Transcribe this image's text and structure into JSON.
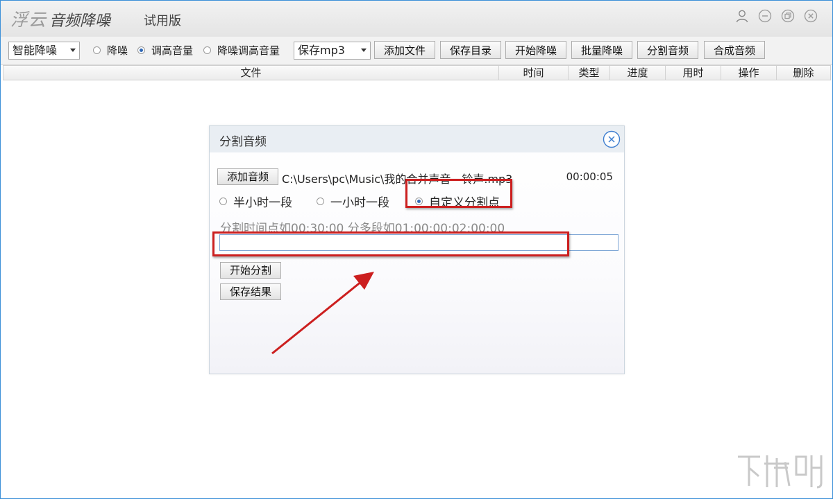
{
  "app": {
    "brand": "浮云",
    "product": "音频降噪",
    "edition": "试用版"
  },
  "toolbar": {
    "mode_select": "智能降噪",
    "radios": [
      {
        "label": "降噪",
        "checked": false
      },
      {
        "label": "调高音量",
        "checked": true
      },
      {
        "label": "降噪调高音量",
        "checked": false
      }
    ],
    "format_select": "保存mp3",
    "buttons": [
      "添加文件",
      "保存目录",
      "开始降噪",
      "批量降噪",
      "分割音频",
      "合成音频"
    ]
  },
  "table": {
    "columns": [
      "文件",
      "时间",
      "类型",
      "进度",
      "用时",
      "操作",
      "删除"
    ]
  },
  "dialog": {
    "title": "分割音频",
    "add_button": "添加音频",
    "file_path": "C:\\Users\\pc\\Music\\我的合并声音 - 铃声.mp3",
    "duration": "00:00:05",
    "options": [
      {
        "label": "半小时一段",
        "checked": false
      },
      {
        "label": "一小时一段",
        "checked": false
      },
      {
        "label": "自定义分割点",
        "checked": true
      }
    ],
    "hint": "分割时间点如00:30:00 分多段如01:00:00;02:00:00",
    "split_input_value": "",
    "start_button": "开始分割",
    "save_button": "保存结果"
  },
  "colors": {
    "accent": "#2f67b5",
    "highlight": "#cc1f1f",
    "window_border": "#3a8fd8"
  },
  "watermark": {
    "text": "下载吧"
  }
}
